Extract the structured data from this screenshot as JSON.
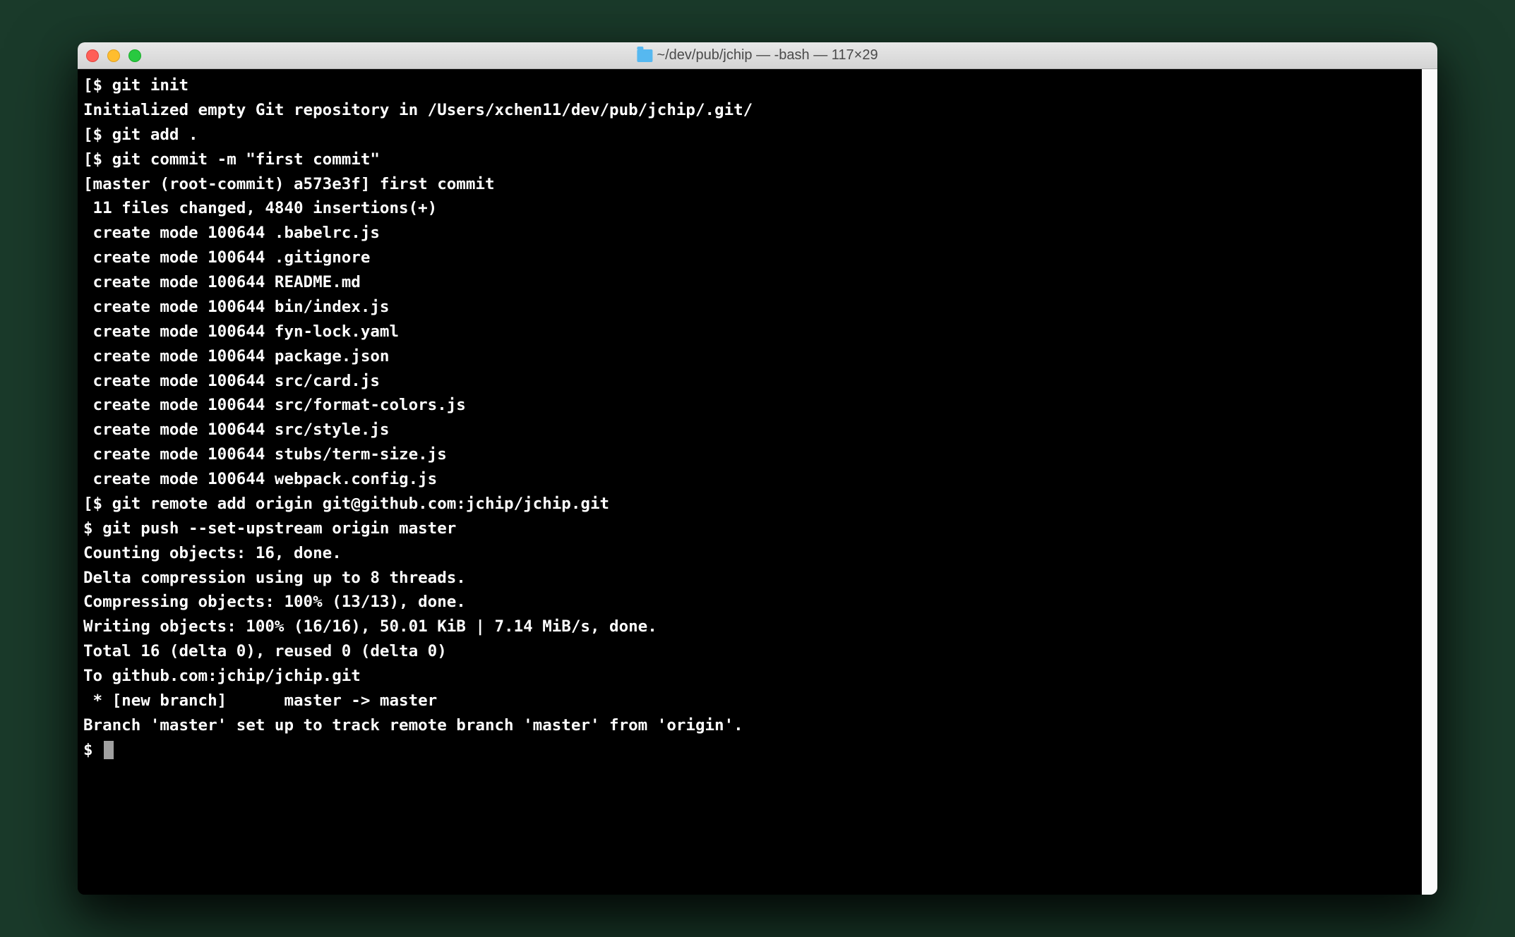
{
  "titlebar": {
    "title": "~/dev/pub/jchip — -bash — 117×29"
  },
  "terminal": {
    "lines": [
      "[$ git init",
      "Initialized empty Git repository in /Users/xchen11/dev/pub/jchip/.git/",
      "[$ git add .",
      "[$ git commit -m \"first commit\"",
      "[master (root-commit) a573e3f] first commit",
      " 11 files changed, 4840 insertions(+)",
      " create mode 100644 .babelrc.js",
      " create mode 100644 .gitignore",
      " create mode 100644 README.md",
      " create mode 100644 bin/index.js",
      " create mode 100644 fyn-lock.yaml",
      " create mode 100644 package.json",
      " create mode 100644 src/card.js",
      " create mode 100644 src/format-colors.js",
      " create mode 100644 src/style.js",
      " create mode 100644 stubs/term-size.js",
      " create mode 100644 webpack.config.js",
      "[$ git remote add origin git@github.com:jchip/jchip.git",
      "$ git push --set-upstream origin master",
      "Counting objects: 16, done.",
      "Delta compression using up to 8 threads.",
      "Compressing objects: 100% (13/13), done.",
      "Writing objects: 100% (16/16), 50.01 KiB | 7.14 MiB/s, done.",
      "Total 16 (delta 0), reused 0 (delta 0)",
      "To github.com:jchip/jchip.git",
      " * [new branch]      master -> master",
      "Branch 'master' set up to track remote branch 'master' from 'origin'."
    ],
    "prompt": "$ "
  }
}
